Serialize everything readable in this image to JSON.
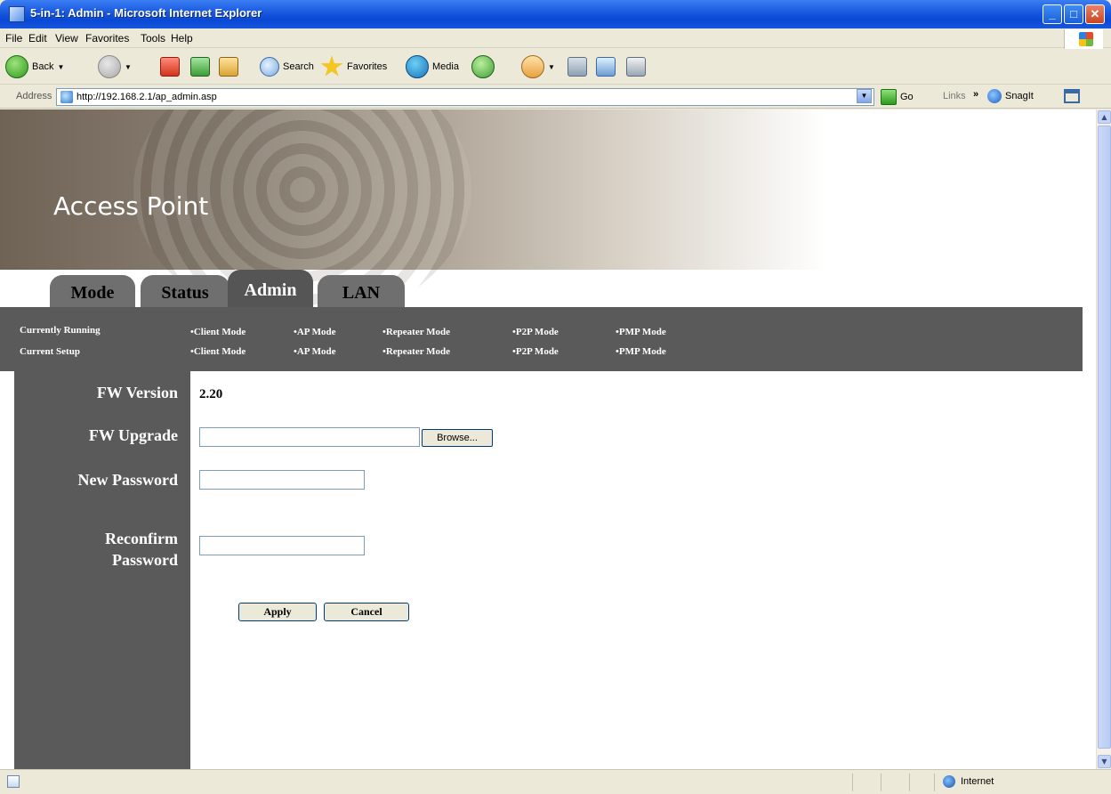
{
  "window": {
    "title": "5-in-1: Admin - Microsoft Internet Explorer"
  },
  "menu": [
    "File",
    "Edit",
    "View",
    "Favorites",
    "Tools",
    "Help"
  ],
  "toolbar": {
    "back": "Back",
    "search": "Search",
    "favorites": "Favorites",
    "media": "Media"
  },
  "address": {
    "label": "Address",
    "url": "http://192.168.2.1/ap_admin.asp",
    "go": "Go",
    "links": "Links",
    "more": "»",
    "snagit": "SnagIt"
  },
  "banner": {
    "title": "Access Point"
  },
  "tabs": [
    "Mode",
    "Status",
    "Admin",
    "LAN"
  ],
  "active_tab": "Admin",
  "modebar": {
    "running_label": "Currently Running",
    "setup_label": "Current Setup",
    "running_modes": [
      "•Client Mode",
      "•AP Mode",
      "•Repeater Mode",
      "•P2P Mode",
      "•PMP Mode"
    ],
    "setup_modes": [
      "•Client Mode",
      "•AP Mode",
      "•Repeater Mode",
      "•P2P Mode",
      "•PMP Mode"
    ]
  },
  "form": {
    "fw_version_label": "FW Version",
    "fw_version_value": "2.20",
    "fw_upgrade_label": "FW Upgrade",
    "fw_upgrade_value": "",
    "browse_label": "Browse...",
    "new_password_label": "New Password",
    "new_password_value": "",
    "reconfirm_label_1": "Reconfirm",
    "reconfirm_label_2": "Password",
    "reconfirm_value": "",
    "apply_label": "Apply",
    "cancel_label": "Cancel"
  },
  "status": {
    "zone": "Internet"
  }
}
